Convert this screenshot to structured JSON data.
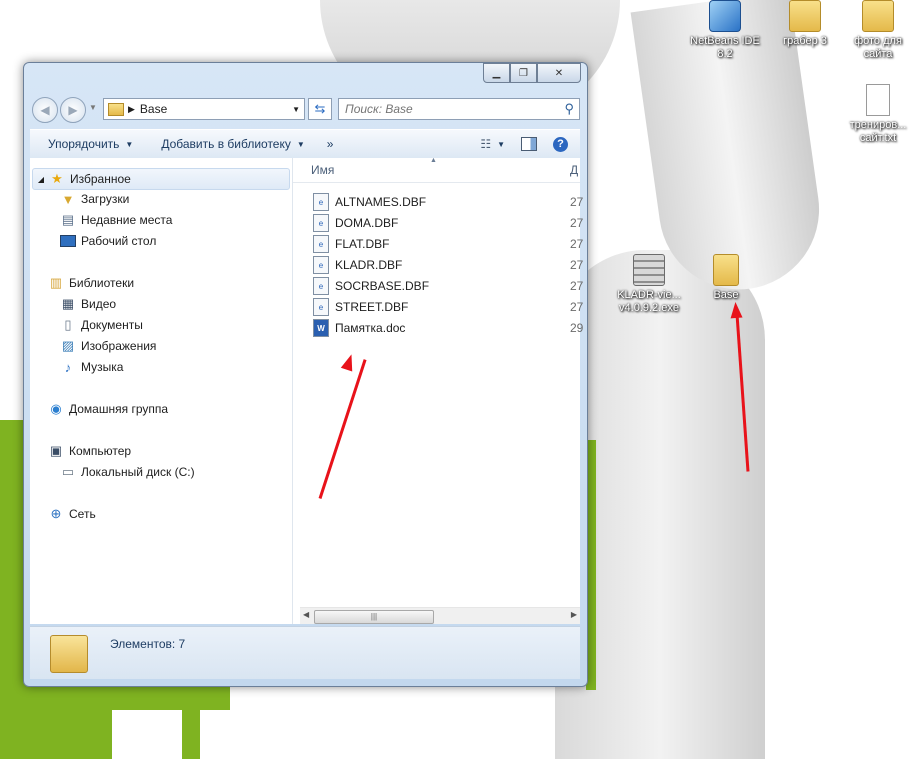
{
  "desktop": {
    "icons": [
      {
        "label": "NetBeans IDE 8.2",
        "icon": "netbeans-icon"
      },
      {
        "label": "грабер 3",
        "icon": "folder-tool-icon"
      },
      {
        "label": "фото для сайта",
        "icon": "folder-icon"
      },
      {
        "label": "трениров... сайт.txt",
        "icon": "text-file-icon"
      },
      {
        "label": "KLADR-vie... v4.0.9.2.exe",
        "icon": "exe-icon"
      },
      {
        "label": "Base",
        "icon": "folder-icon"
      }
    ]
  },
  "window": {
    "address": {
      "segment": "Base"
    },
    "search": {
      "placeholder": "Поиск: Base"
    },
    "toolbar": {
      "organize": "Упорядочить",
      "add_to_library": "Добавить в библиотеку",
      "more": "»"
    },
    "nav": {
      "favorites": "Избранное",
      "favorites_items": [
        "Загрузки",
        "Недавние места",
        "Рабочий стол"
      ],
      "libraries": "Библиотеки",
      "libraries_items": [
        "Видео",
        "Документы",
        "Изображения",
        "Музыка"
      ],
      "homegroup": "Домашняя группа",
      "computer": "Компьютер",
      "computer_items": [
        "Локальный диск (C:)"
      ],
      "network": "Сеть"
    },
    "columns": {
      "name": "Имя",
      "date": "Д"
    },
    "files": [
      {
        "name": "ALTNAMES.DBF",
        "date": "27"
      },
      {
        "name": "DOMA.DBF",
        "date": "27"
      },
      {
        "name": "FLAT.DBF",
        "date": "27"
      },
      {
        "name": "KLADR.DBF",
        "date": "27"
      },
      {
        "name": "SOCRBASE.DBF",
        "date": "27"
      },
      {
        "name": "STREET.DBF",
        "date": "27"
      },
      {
        "name": "Памятка.doc",
        "date": "29"
      }
    ],
    "status": {
      "items_count": "Элементов: 7"
    }
  },
  "colors": {
    "wallpaper_green": "#7fb321",
    "arrow_red": "#e8121a",
    "selection": "#dfeaf7"
  }
}
